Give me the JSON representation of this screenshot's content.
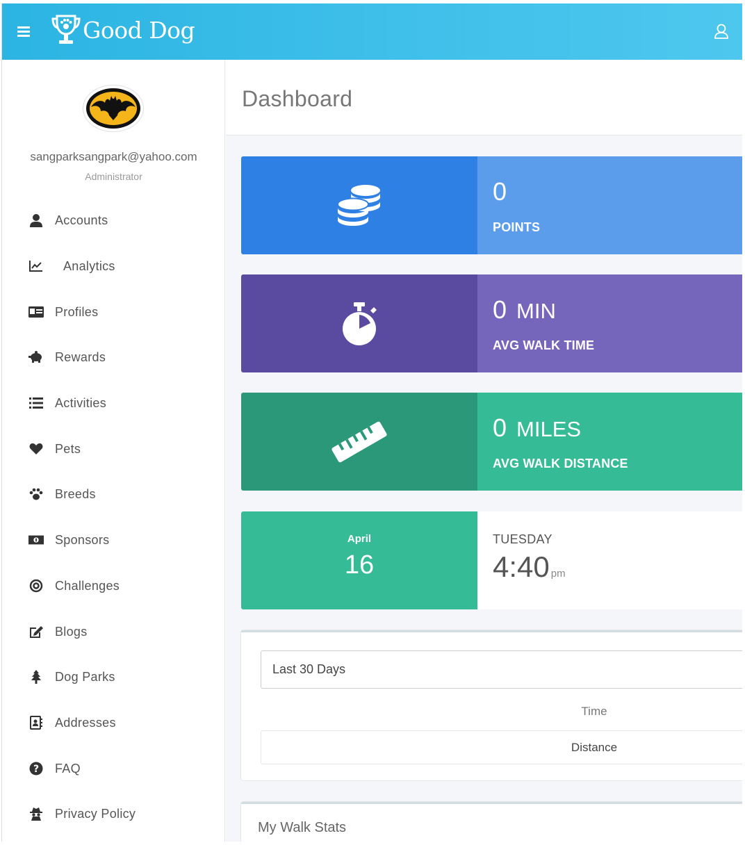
{
  "header": {
    "brand": "Good Dog"
  },
  "user": {
    "email": "sangparksangpark@yahoo.com",
    "role": "Administrator"
  },
  "sidebar": {
    "items": [
      {
        "label": "Accounts",
        "icon": "user-icon"
      },
      {
        "label": "Analytics",
        "icon": "line-chart-icon"
      },
      {
        "label": "Profiles",
        "icon": "id-card-icon"
      },
      {
        "label": "Rewards",
        "icon": "piggy-bank-icon"
      },
      {
        "label": "Activities",
        "icon": "list-icon"
      },
      {
        "label": "Pets",
        "icon": "heart-icon"
      },
      {
        "label": "Breeds",
        "icon": "paw-icon"
      },
      {
        "label": "Sponsors",
        "icon": "money-bill-icon"
      },
      {
        "label": "Challenges",
        "icon": "target-icon"
      },
      {
        "label": "Blogs",
        "icon": "edit-icon"
      },
      {
        "label": "Dog Parks",
        "icon": "tree-icon"
      },
      {
        "label": "Addresses",
        "icon": "address-book-icon"
      },
      {
        "label": "FAQ",
        "icon": "question-circle-icon"
      },
      {
        "label": "Privacy Policy",
        "icon": "spy-icon"
      }
    ]
  },
  "main": {
    "title": "Dashboard",
    "stats": [
      {
        "value": "0",
        "unit": "",
        "label": "POINTS",
        "icon": "coins-icon",
        "color_dark": "#2f80e4",
        "color_light": "#5b9deb"
      },
      {
        "value": "0",
        "unit": "MIN",
        "label": "AVG WALK TIME",
        "icon": "stopwatch-icon",
        "color_dark": "#5a4aa0",
        "color_light": "#7566bb"
      },
      {
        "value": "0",
        "unit": "MILES",
        "label": "AVG WALK DISTANCE",
        "icon": "ruler-icon",
        "color_dark": "#2b987a",
        "color_light": "#36bb97"
      }
    ],
    "date": {
      "month": "April",
      "day": "16",
      "weekday": "TUESDAY",
      "time": "4:40",
      "ampm": "pm"
    },
    "range_select": {
      "selected": "Last 30 Days",
      "options_visible": [
        "Time",
        "Distance"
      ]
    },
    "walk_stats_title": "My Walk Stats"
  }
}
